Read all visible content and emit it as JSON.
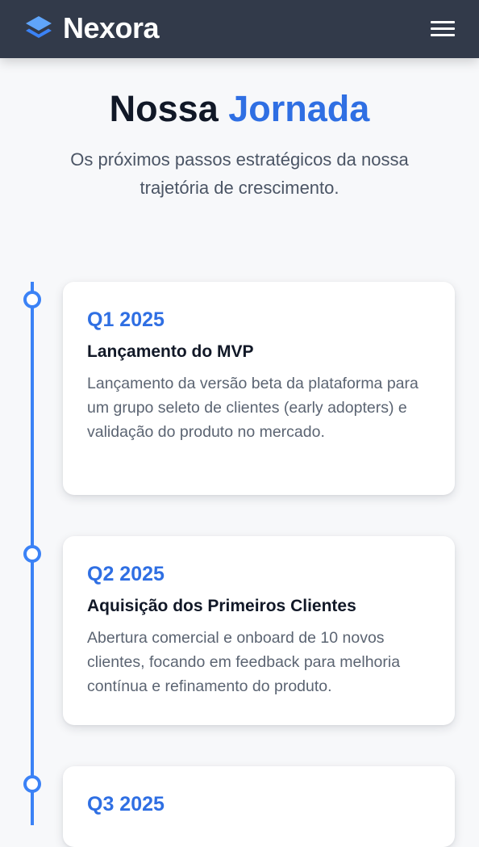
{
  "header": {
    "brand": "Nexora",
    "logo_icon": "layers-icon",
    "menu_icon": "hamburger-menu-icon"
  },
  "hero": {
    "title_part1": "Nossa",
    "title_part2": "Jornada",
    "subtitle": "Os próximos passos estratégicos da nossa trajetória de crescimento."
  },
  "timeline": {
    "items": [
      {
        "quarter": "Q1 2025",
        "title": "Lançamento do MVP",
        "description": "Lançamento da versão beta da plataforma para um grupo seleto de clientes (early adopters) e validação do produto no mercado."
      },
      {
        "quarter": "Q2 2025",
        "title": "Aquisição dos Primeiros Clientes",
        "description": "Abertura comercial e onboard de 10 novos clientes, focando em feedback para melhoria contínua e refinamento do produto."
      },
      {
        "quarter": "Q3 2025",
        "title": "",
        "description": ""
      }
    ]
  },
  "colors": {
    "header_bg": "#323a4a",
    "accent": "#2f6fe3",
    "timeline": "#3b82f6",
    "page_bg": "#f7f8fa"
  }
}
